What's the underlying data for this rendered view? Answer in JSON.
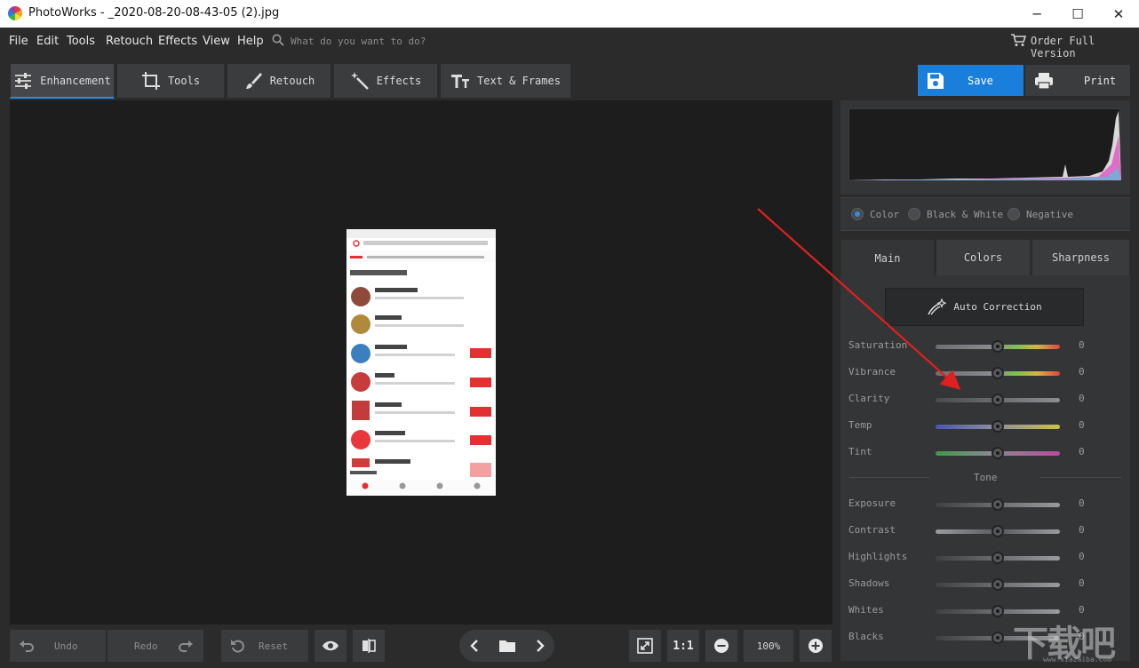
{
  "window": {
    "title": "PhotoWorks - _2020-08-20-08-43-05 (2).jpg",
    "minimize": "─",
    "maximize": "☐",
    "close": "✕"
  },
  "menu": {
    "items": [
      "File",
      "Edit",
      "Tools",
      "Retouch",
      "Effects",
      "View",
      "Help"
    ],
    "search_placeholder": "What do you want to do?",
    "order_label": "Order Full Version"
  },
  "tabs": [
    {
      "label": "Enhancement",
      "icon": "sliders-icon",
      "active": true
    },
    {
      "label": "Tools",
      "icon": "crop-icon",
      "active": false
    },
    {
      "label": "Retouch",
      "icon": "brush-icon",
      "active": false
    },
    {
      "label": "Effects",
      "icon": "magic-wand-icon",
      "active": false
    },
    {
      "label": "Text & Frames",
      "icon": "text-icon",
      "active": false
    }
  ],
  "actions": {
    "save": "Save",
    "print": "Print"
  },
  "bottom": {
    "undo": "Undo",
    "redo": "Redo",
    "reset": "Reset",
    "zoom_fit": "1:1",
    "zoom": "100%"
  },
  "color_modes": {
    "options": [
      "Color",
      "Black & White",
      "Negative"
    ],
    "selected": "Color"
  },
  "panel_tabs": [
    {
      "label": "Main",
      "active": true
    },
    {
      "label": "Colors",
      "active": false
    },
    {
      "label": "Sharpness",
      "active": false
    }
  ],
  "auto_correction": "Auto Correction",
  "sliders": [
    {
      "label": "Saturation",
      "value": "0",
      "track": "saturation"
    },
    {
      "label": "Vibrance",
      "value": "0",
      "track": "saturation"
    },
    {
      "label": "Clarity",
      "value": "0",
      "track": "gray"
    },
    {
      "label": "Temp",
      "value": "0",
      "track": "temp"
    },
    {
      "label": "Tint",
      "value": "0",
      "track": "tint"
    }
  ],
  "tone": {
    "label": "Tone",
    "sliders": [
      {
        "label": "Exposure",
        "value": "0"
      },
      {
        "label": "Contrast",
        "value": "0"
      },
      {
        "label": "Highlights",
        "value": "0"
      },
      {
        "label": "Shadows",
        "value": "0"
      },
      {
        "label": "Whites",
        "value": "0"
      },
      {
        "label": "Blacks",
        "value": "0"
      }
    ]
  },
  "photo": {
    "top_tab_active": "关注",
    "top_tabs": [
      "推荐",
      "电视剧",
      "电影",
      "小视频",
      "游戏",
      "综艺",
      "V"
    ],
    "section_title": "为你推荐优质作者",
    "authors": [
      {
        "name": "英雄联盟维修部",
        "action": ""
      },
      {
        "name": "小象兼美",
        "action": ""
      },
      {
        "name": "熊猫大战车",
        "action": "关注"
      },
      {
        "name": "搞笑机",
        "action": "关注"
      },
      {
        "name": "咒一家族",
        "action": "关注"
      },
      {
        "name": "好歌我来唱",
        "action": "关注"
      },
      {
        "name": "搞笑机利器美",
        "action": ""
      }
    ],
    "bottom_nav": [
      "首页",
      "发现",
      "消息",
      "我的"
    ]
  },
  "watermark": {
    "text": "下载吧",
    "sub": "www.xiazaiba.com"
  },
  "colors": {
    "accent": "#2b8de3",
    "save_button": "#1a7fdb",
    "arrow": "#e02020",
    "photo_accent": "#e33030"
  }
}
